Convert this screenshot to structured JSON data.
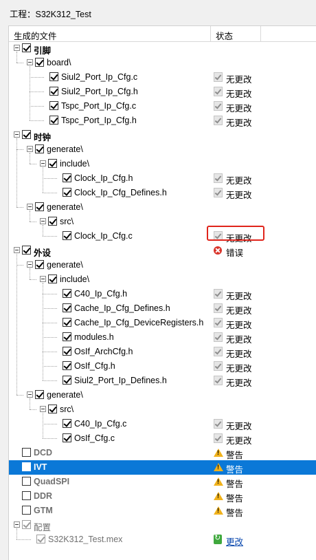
{
  "title": "工程：S32K312_Test",
  "columns": {
    "name": "生成的文件",
    "status": "状态"
  },
  "status_labels": {
    "unchanged": "无更改",
    "error": "错误",
    "warning": "警告",
    "update": "更改"
  },
  "colors": {
    "selection": "#0b78d7",
    "error_outline": "#e0241b",
    "warning": "#f1b21b",
    "link": "#0645ad"
  },
  "rows": [
    {
      "label": "引脚",
      "level": 0,
      "expander": true,
      "checked": true,
      "bold": true
    },
    {
      "label": "board\\",
      "level": 1,
      "expander": true,
      "checked": true
    },
    {
      "label": "Siul2_Port_Ip_Cfg.c",
      "level": 2,
      "checked": true,
      "status": "unchanged"
    },
    {
      "label": "Siul2_Port_Ip_Cfg.h",
      "level": 2,
      "checked": true,
      "status": "unchanged"
    },
    {
      "label": "Tspc_Port_Ip_Cfg.c",
      "level": 2,
      "checked": true,
      "status": "unchanged"
    },
    {
      "label": "Tspc_Port_Ip_Cfg.h",
      "level": 2,
      "checked": true,
      "status": "unchanged"
    },
    {
      "label": "时钟",
      "level": 0,
      "expander": true,
      "checked": true,
      "bold": true
    },
    {
      "label": "generate\\",
      "level": 1,
      "expander": true,
      "checked": true
    },
    {
      "label": "include\\",
      "level": 2,
      "expander": true,
      "checked": true
    },
    {
      "label": "Clock_Ip_Cfg.h",
      "level": 3,
      "checked": true,
      "status": "unchanged"
    },
    {
      "label": "Clock_Ip_Cfg_Defines.h",
      "level": 3,
      "checked": true,
      "status": "unchanged"
    },
    {
      "label": "generate\\",
      "level": 1,
      "expander": true,
      "checked": true
    },
    {
      "label": "src\\",
      "level": 2,
      "expander": true,
      "checked": true
    },
    {
      "label": "Clock_Ip_Cfg.c",
      "level": 3,
      "checked": true,
      "status": "unchanged"
    },
    {
      "label": "外设",
      "level": 0,
      "expander": true,
      "checked": true,
      "bold": true,
      "status": "error"
    },
    {
      "label": "generate\\",
      "level": 1,
      "expander": true,
      "checked": true
    },
    {
      "label": "include\\",
      "level": 2,
      "expander": true,
      "checked": true
    },
    {
      "label": "C40_Ip_Cfg.h",
      "level": 3,
      "checked": true,
      "status": "unchanged"
    },
    {
      "label": "Cache_Ip_Cfg_Defines.h",
      "level": 3,
      "checked": true,
      "status": "unchanged"
    },
    {
      "label": "Cache_Ip_Cfg_DeviceRegisters.h",
      "level": 3,
      "checked": true,
      "status": "unchanged"
    },
    {
      "label": "modules.h",
      "level": 3,
      "checked": true,
      "status": "unchanged"
    },
    {
      "label": "OsIf_ArchCfg.h",
      "level": 3,
      "checked": true,
      "status": "unchanged"
    },
    {
      "label": "OsIf_Cfg.h",
      "level": 3,
      "checked": true,
      "status": "unchanged"
    },
    {
      "label": "Siul2_Port_Ip_Defines.h",
      "level": 3,
      "checked": true,
      "status": "unchanged"
    },
    {
      "label": "generate\\",
      "level": 1,
      "expander": true,
      "checked": true
    },
    {
      "label": "src\\",
      "level": 2,
      "expander": true,
      "checked": true
    },
    {
      "label": "C40_Ip_Cfg.c",
      "level": 3,
      "checked": true,
      "status": "unchanged"
    },
    {
      "label": "OsIf_Cfg.c",
      "level": 3,
      "checked": true,
      "status": "unchanged"
    },
    {
      "label": "DCD",
      "level": 0,
      "checked": false,
      "grey": true,
      "bold": true,
      "status": "warning"
    },
    {
      "label": "IVT",
      "level": 0,
      "checked": false,
      "grey": true,
      "bold": true,
      "status": "warning",
      "selected": true
    },
    {
      "label": "QuadSPI",
      "level": 0,
      "checked": false,
      "grey": true,
      "bold": true,
      "status": "warning"
    },
    {
      "label": "DDR",
      "level": 0,
      "checked": false,
      "grey": true,
      "bold": true,
      "status": "warning"
    },
    {
      "label": "GTM",
      "level": 0,
      "checked": false,
      "grey": true,
      "bold": true,
      "status": "warning"
    },
    {
      "label": "配置",
      "level": 0,
      "expander": true,
      "checked": true,
      "disabled": true,
      "grey": true
    },
    {
      "label": "S32K312_Test.mex",
      "level": 1,
      "checked": true,
      "disabled": true,
      "grey": true,
      "status": "update"
    }
  ]
}
